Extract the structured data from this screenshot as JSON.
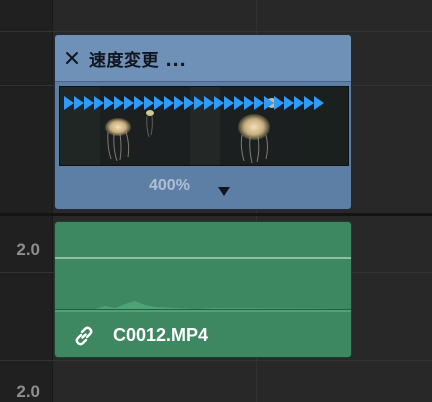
{
  "video_clip": {
    "title": "速度変更 ...",
    "speed": "400%",
    "speed_arrow_count": 26,
    "colors": {
      "clip": "#5d7fa6",
      "header": "#6f90b7",
      "arrows": "#2e9bff"
    }
  },
  "audio_clip": {
    "name": "C0012.MP4",
    "colors": {
      "clip": "#3d8861"
    }
  },
  "track_labels": [
    "2.0",
    "2.0"
  ],
  "icons": {
    "close": "close-icon",
    "dropdown": "triangle-down-icon",
    "link": "link-icon"
  }
}
